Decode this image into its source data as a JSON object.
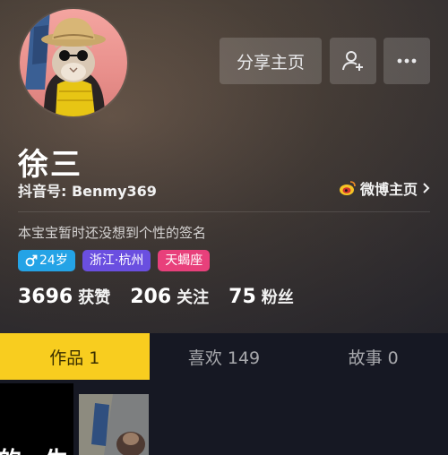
{
  "colors": {
    "tab_active_bg": "#f8cd1f",
    "tag_gender": "#24a3e6",
    "tag_location": "#6a4fe0",
    "tag_zodiac": "#e8407b"
  },
  "header": {
    "share_label": "分享主页",
    "follow_icon": "add-user-icon",
    "more_icon": "more-icon"
  },
  "profile": {
    "nickname": "徐三",
    "douyin_id": "抖音号: Benmy369",
    "weibo_label": "微博主页",
    "bio": "本宝宝暂时还没想到个性的签名",
    "tags": {
      "gender_age": "24岁",
      "location": "浙江·杭州",
      "zodiac": "天蝎座"
    }
  },
  "stats": {
    "likes_value": "3696",
    "likes_label": "获赞",
    "following_value": "206",
    "following_label": "关注",
    "fans_value": "75",
    "fans_label": "粉丝"
  },
  "tabs": [
    {
      "label": "作品 1",
      "active": true
    },
    {
      "label": "喜欢 149",
      "active": false
    },
    {
      "label": "故事 0",
      "active": false
    }
  ],
  "videos": {
    "first_caption": "的一生"
  }
}
